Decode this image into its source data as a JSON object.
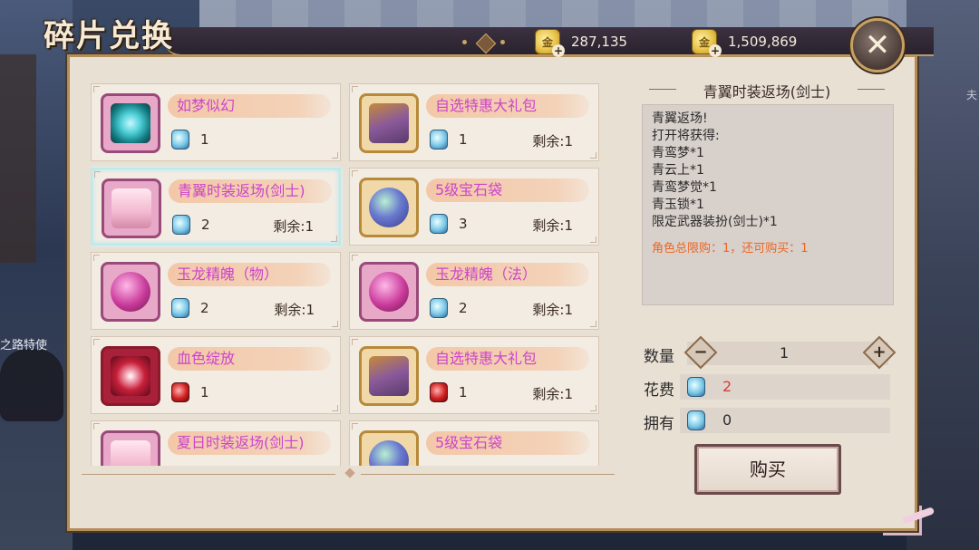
{
  "title": "碎片兑换",
  "background": {
    "npc_label": "之路特使",
    "right_label": "夫"
  },
  "currencies": [
    {
      "icon": "gold-coin-icon",
      "value": "287,135"
    },
    {
      "icon": "gold-coin-icon",
      "value": "1,509,869"
    }
  ],
  "close_label": "✕",
  "items": [
    {
      "name": "如梦似幻",
      "cost": "1",
      "remain": "",
      "cost_color": "blue",
      "icon": "magic-crystal-icon"
    },
    {
      "name": "自选特惠大礼包",
      "cost": "1",
      "remain": "剩余:1",
      "cost_color": "blue",
      "icon": "gift-chest-icon"
    },
    {
      "name": "青翼时装返场(剑士)",
      "cost": "2",
      "remain": "剩余:1",
      "cost_color": "blue",
      "icon": "costume-scroll-icon",
      "selected": true
    },
    {
      "name": "5级宝石袋",
      "cost": "3",
      "remain": "剩余:1",
      "cost_color": "blue",
      "icon": "gem-bag-icon"
    },
    {
      "name": "玉龙精魄（物）",
      "cost": "2",
      "remain": "剩余:1",
      "cost_color": "blue",
      "icon": "dragon-orb-icon"
    },
    {
      "name": "玉龙精魄（法）",
      "cost": "2",
      "remain": "剩余:1",
      "cost_color": "blue",
      "icon": "dragon-orb-icon"
    },
    {
      "name": "血色绽放",
      "cost": "1",
      "remain": "",
      "cost_color": "red",
      "icon": "blood-bloom-icon"
    },
    {
      "name": "自选特惠大礼包",
      "cost": "1",
      "remain": "剩余:1",
      "cost_color": "red",
      "icon": "gift-chest-icon"
    },
    {
      "name": "夏日时装返场(剑士)",
      "cost": "",
      "remain": "",
      "cost_color": "red",
      "icon": "costume-scroll-icon"
    },
    {
      "name": "5级宝石袋",
      "cost": "",
      "remain": "",
      "cost_color": "red",
      "icon": "gem-bag-icon"
    }
  ],
  "detail": {
    "title": "青翼时装返场(剑士)",
    "lines": [
      "青翼返场!",
      "打开将获得:",
      "青鸾梦*1",
      "青云上*1",
      "青鸾梦觉*1",
      "青玉锁*1",
      "限定武器装扮(剑士)*1"
    ],
    "limit": "角色总限购：1，还可购买：1"
  },
  "purchase": {
    "qty_label": "数量",
    "qty": "1",
    "minus": "−",
    "plus": "+",
    "cost_label": "花费",
    "cost": "2",
    "own_label": "拥有",
    "own": "0",
    "buy_label": "购买"
  },
  "colors": {
    "name_text": "#cc44cc",
    "limit_text": "#ee6622",
    "cost_text": "#d2403a"
  }
}
